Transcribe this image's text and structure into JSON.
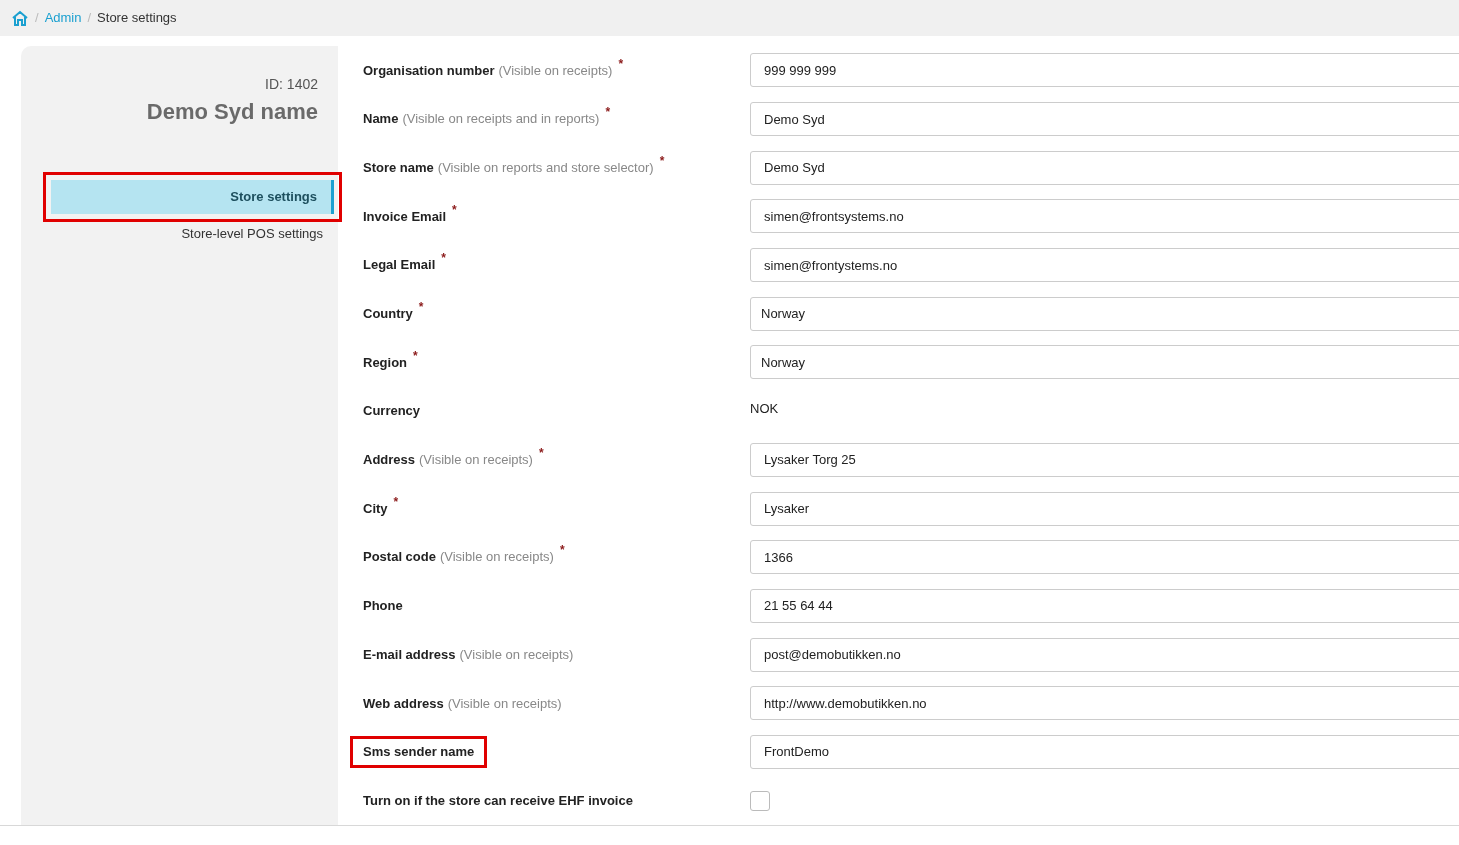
{
  "breadcrumb": [
    {
      "separator": "/",
      "label": "Admin",
      "link": true
    },
    {
      "separator": "/",
      "label": "Store settings",
      "link": false
    }
  ],
  "sidebar": {
    "id_label": "ID: 1402",
    "title": "Demo Syd name",
    "items": [
      {
        "label": "Store settings",
        "selected": true,
        "highlighted": true
      },
      {
        "label": "Store-level POS settings",
        "selected": false,
        "highlighted": false
      }
    ]
  },
  "fields": [
    {
      "label": "Organisation number",
      "hint": "(Visible on receipts)",
      "required_mark": "*",
      "kind": "text",
      "value": "999 999 999",
      "highlighted": false
    },
    {
      "label": "Name",
      "hint": "(Visible on receipts and in reports)",
      "required_mark": "*",
      "kind": "text",
      "value": "Demo Syd",
      "highlighted": false
    },
    {
      "label": "Store name",
      "hint": "(Visible on reports and store selector)",
      "required_mark": "*",
      "kind": "text",
      "value": "Demo Syd",
      "highlighted": false
    },
    {
      "label": "Invoice Email",
      "required_mark": "*",
      "kind": "text",
      "value": "simen@frontsystems.no",
      "highlighted": false
    },
    {
      "label": "Legal Email",
      "required_mark": "*",
      "kind": "text",
      "value": "simen@frontystems.no",
      "highlighted": false
    },
    {
      "label": "Country",
      "required_mark": "*",
      "kind": "select",
      "value": "Norway",
      "highlighted": false
    },
    {
      "label": "Region",
      "required_mark": "*",
      "kind": "select",
      "value": "Norway",
      "highlighted": false
    },
    {
      "label": "Currency",
      "kind": "static",
      "value": "NOK",
      "highlighted": false
    },
    {
      "label": "Address",
      "hint": "(Visible on receipts)",
      "required_mark": "*",
      "kind": "text",
      "value": "Lysaker Torg 25",
      "highlighted": false
    },
    {
      "label": "City",
      "required_mark": "*",
      "kind": "text",
      "value": "Lysaker",
      "highlighted": false
    },
    {
      "label": "Postal code",
      "hint": "(Visible on receipts)",
      "required_mark": "*",
      "kind": "text",
      "value": "1366",
      "highlighted": false
    },
    {
      "label": "Phone",
      "kind": "text",
      "value": "21 55 64 44",
      "highlighted": false
    },
    {
      "label": "E-mail address",
      "hint": "(Visible on receipts)",
      "kind": "text",
      "value": "post@demobutikken.no",
      "highlighted": false
    },
    {
      "label": "Web address",
      "hint": "(Visible on receipts)",
      "kind": "text",
      "value": "http://www.demobutikken.no",
      "highlighted": false
    },
    {
      "label": "Sms sender name",
      "kind": "text",
      "value": "FrontDemo",
      "highlighted": true
    },
    {
      "label": "Turn on if the store can receive EHF invoice",
      "kind": "checkbox",
      "checked": false,
      "highlighted": false
    }
  ]
}
